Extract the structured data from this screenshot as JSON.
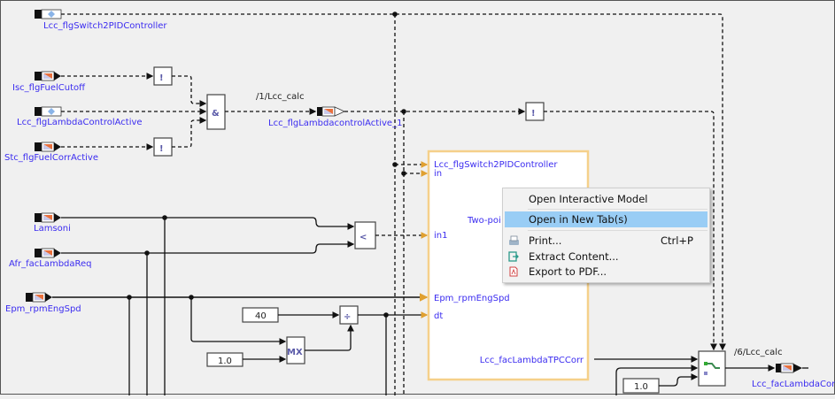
{
  "diagram": {
    "inports": {
      "switch": "Lcc_flgSwitch2PIDController",
      "fuel_cutoff": "Isc_flgFuelCutoff",
      "lambda_active": "Lcc_flgLambdaControlActive",
      "fuel_corr": "Stc_flgFuelCorrActive",
      "lamsoni": "Lamsoni",
      "lambda_req": "Afr_facLambdaReq",
      "eng_spd": "Epm_rpmEngSpd"
    },
    "and_symbol": "&",
    "not_symbol": "!",
    "less_symbol": "<",
    "div_symbol": "÷",
    "mx_symbol": "MX",
    "calc1_label": "/1/Lcc_calc",
    "outport1": "Lcc_flgLambdacontrolActive_1",
    "calc6_label": "/6/Lcc_calc",
    "outport6": "Lcc_facLambdaCorr",
    "const_40": "40",
    "const_1a": "1.0",
    "const_1b": "1.0",
    "subsystem": {
      "ports_in": [
        "Lcc_flgSwitch2PIDController",
        "in",
        "in1",
        "Epm_rpmEngSpd",
        "dt"
      ],
      "name_partial": "Two-poi",
      "port_out": "Lcc_facLambdaTPCCorr",
      "border_color": "#f5d08a"
    }
  },
  "context_menu": {
    "items": [
      {
        "label": "Open Interactive Model"
      },
      {
        "label": "Open in New Tab(s)",
        "highlighted": true
      },
      {
        "label": "Print...",
        "shortcut": "Ctrl+P",
        "icon": "printer-icon"
      },
      {
        "label": "Extract Content...",
        "icon": "extract-icon"
      },
      {
        "label": "Export to PDF...",
        "icon": "pdf-icon"
      }
    ],
    "highlight_color": "#99cdf5"
  }
}
